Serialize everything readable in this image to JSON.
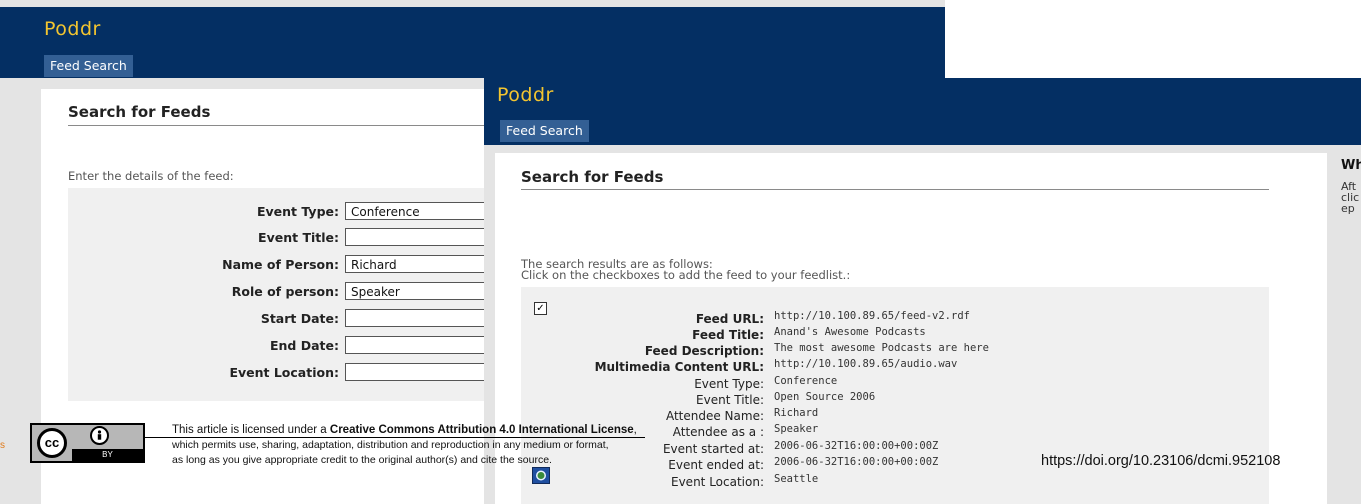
{
  "back": {
    "brand": "Poddr",
    "tab": "Feed Search",
    "heading": "Search for Feeds",
    "intro": "Enter the details of the feed:",
    "fields": [
      {
        "label": "Event Type:",
        "value": "Conference"
      },
      {
        "label": "Event Title:",
        "value": ""
      },
      {
        "label": "Name of Person:",
        "value": "Richard"
      },
      {
        "label": "Role of person:",
        "value": "Speaker"
      },
      {
        "label": "Start Date:",
        "value": ""
      },
      {
        "label": "End Date:",
        "value": ""
      },
      {
        "label": "Event Location:",
        "value": ""
      }
    ]
  },
  "front": {
    "brand": "Poddr",
    "tab": "Feed Search",
    "heading": "Search for Feeds",
    "intro_line1": "The search results are as follows:",
    "intro_line2": "Click on the checkboxes to add the feed to your feedlist.:",
    "side_heading": "Wh",
    "side_text": [
      "Aft",
      "clic",
      "ep"
    ],
    "result": [
      {
        "key": "Feed URL:",
        "value": "http://10.100.89.65/feed-v2.rdf",
        "bold": true
      },
      {
        "key": "Feed Title:",
        "value": "Anand's Awesome Podcasts",
        "bold": true
      },
      {
        "key": "Feed Description:",
        "value": "The most awesome Podcasts are here",
        "bold": true
      },
      {
        "key": "Multimedia Content URL:",
        "value": "http://10.100.89.65/audio.wav",
        "bold": true
      },
      {
        "key": "Event Type:",
        "value": "Conference",
        "bold": false
      },
      {
        "key": "Event Title:",
        "value": "Open Source 2006",
        "bold": false
      },
      {
        "key": "Attendee Name:",
        "value": "Richard",
        "bold": false
      },
      {
        "key": "Attendee as a :",
        "value": "Speaker",
        "bold": false
      },
      {
        "key": "Event started at:",
        "value": "2006-06-32T16:00:00+00:00Z",
        "bold": false
      },
      {
        "key": "Event ended at:",
        "value": "2006-06-32T16:00:00+00:00Z",
        "bold": false
      },
      {
        "key": "Event Location:",
        "value": "Seattle",
        "bold": false
      }
    ]
  },
  "license": {
    "edge_letter": "s",
    "badge_cc": "cc",
    "badge_by": "BY",
    "line1_pre": "This article is licensed under a ",
    "line1_bold": "Creative Commons Attribution 4.0 International License",
    "line1_post": ",",
    "line2": "which permits use, sharing, adaptation, distribution and reproduction in any medium or format,",
    "line3": "as long as you give appropriate credit to the original author(s) and cite the source.",
    "doi": "https://doi.org/10.23106/dcmi.952108"
  },
  "colors": {
    "header": "#042f63",
    "brand": "#f3c530",
    "tab": "#335f94",
    "panel": "#f0f0f0"
  }
}
